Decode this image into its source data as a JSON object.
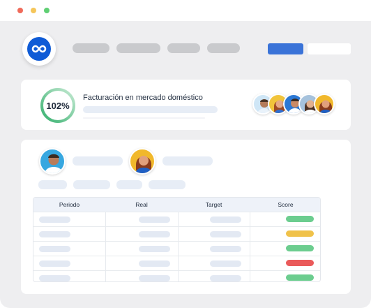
{
  "window": {
    "controls": {
      "close_color": "#f06a5a",
      "minimize_color": "#f5c65a",
      "zoom_color": "#5fcf73"
    }
  },
  "header": {
    "logo_icon": "infinity-logo-icon",
    "brand_color": "#0f5bd6",
    "nav_items": 4,
    "primary_button_color": "#3a73d8"
  },
  "kpi": {
    "value": "102%",
    "progress_percent": 102,
    "gauge_color": "#3db87a",
    "title": "Facturación en mercado doméstico"
  },
  "team": {
    "avatars": [
      "avatar-1",
      "avatar-2",
      "avatar-3",
      "avatar-4",
      "avatar-5"
    ]
  },
  "table": {
    "headers": [
      "Periodo",
      "Real",
      "Target",
      "Score"
    ],
    "score_colors": [
      "#6ccd8f",
      "#f0c24a",
      "#6ccd8f",
      "#ea5a5a",
      "#6ccd8f"
    ],
    "score_status": [
      "green",
      "yellow",
      "green",
      "red",
      "green"
    ]
  }
}
